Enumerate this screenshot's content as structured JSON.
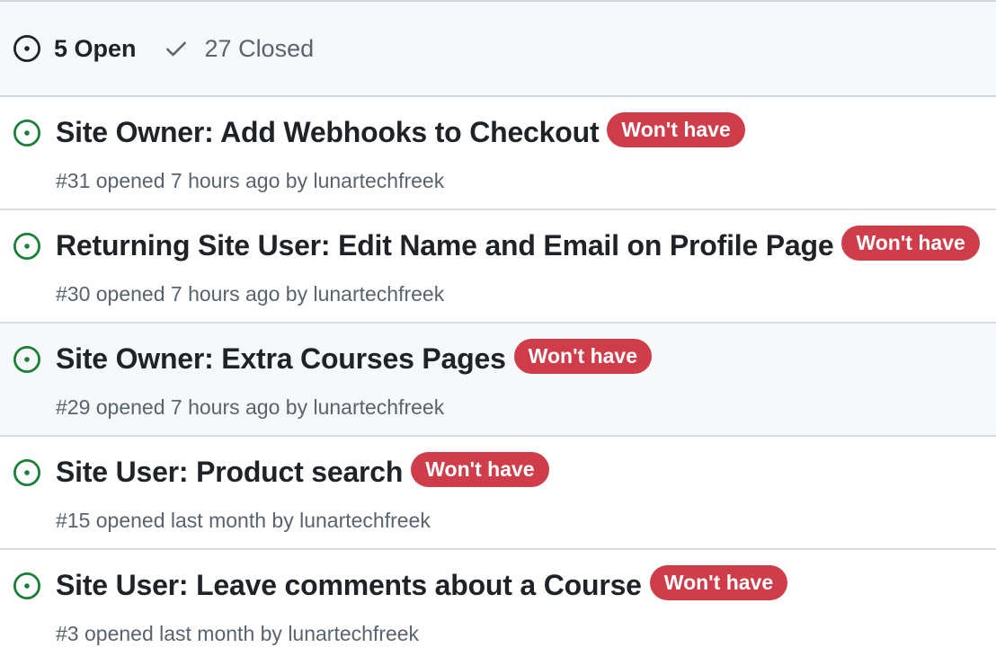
{
  "header": {
    "open_count_label": "5 Open",
    "closed_count_label": "27 Closed"
  },
  "colors": {
    "open_icon": "#1a7f37",
    "label_wont_have": "#cf3d4a"
  },
  "issues": [
    {
      "title": "Site Owner: Add Webhooks to Checkout",
      "label": "Won't have",
      "number": "#31",
      "opened_text": "opened 7 hours ago by",
      "author": "lunartechfreek"
    },
    {
      "title": "Returning Site User: Edit Name and Email on Profile Page",
      "label": "Won't have",
      "number": "#30",
      "opened_text": "opened 7 hours ago by",
      "author": "lunartechfreek"
    },
    {
      "title": "Site Owner: Extra Courses Pages",
      "label": "Won't have",
      "number": "#29",
      "opened_text": "opened 7 hours ago by",
      "author": "lunartechfreek"
    },
    {
      "title": "Site User: Product search",
      "label": "Won't have",
      "number": "#15",
      "opened_text": "opened last month by",
      "author": "lunartechfreek"
    },
    {
      "title": "Site User: Leave comments about a Course",
      "label": "Won't have",
      "number": "#3",
      "opened_text": "opened last month by",
      "author": "lunartechfreek"
    }
  ]
}
